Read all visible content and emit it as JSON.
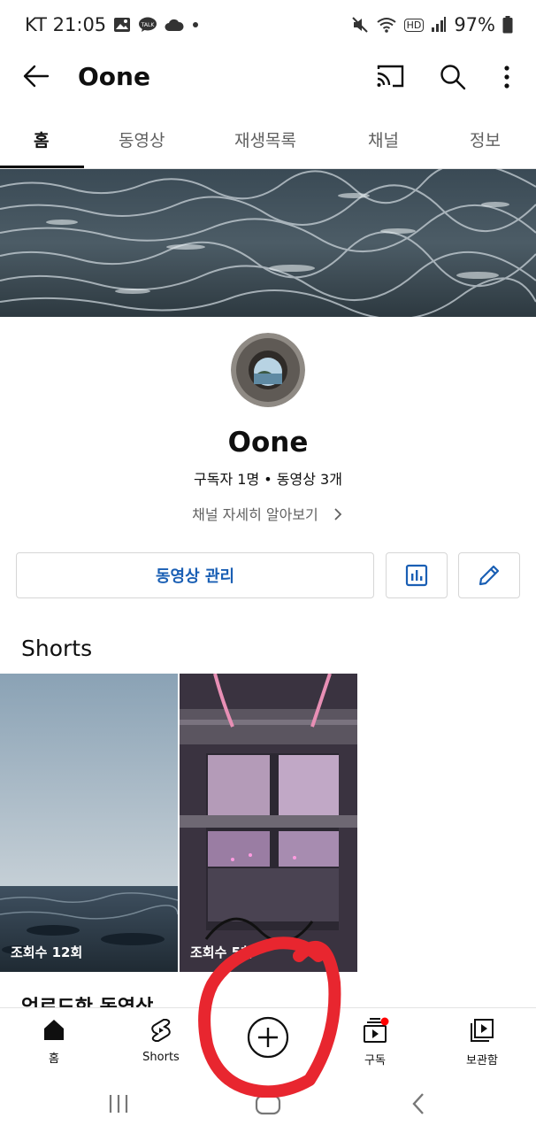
{
  "status": {
    "carrier_time": "KT 21:05",
    "battery": "97%",
    "hd": "HD"
  },
  "header": {
    "title": "Oone"
  },
  "tabs": [
    {
      "label": "홈",
      "active": true
    },
    {
      "label": "동영상"
    },
    {
      "label": "재생목록"
    },
    {
      "label": "채널"
    },
    {
      "label": "정보"
    }
  ],
  "channel": {
    "name": "Oone",
    "meta": "구독자 1명 • 동영상 3개",
    "more": "채널 자세히 알아보기"
  },
  "actions": {
    "manage_videos": "동영상 관리"
  },
  "shorts": {
    "title": "Shorts",
    "items": [
      {
        "views": "조회수 12회"
      },
      {
        "views": "조회수 5회"
      }
    ]
  },
  "uploaded_title": "업로드한 동영상",
  "bottom_nav": {
    "home": "홈",
    "shorts": "Shorts",
    "subscriptions": "구독",
    "library": "보관함"
  },
  "colors": {
    "accent_blue": "#1a5fb4",
    "annotation_red": "#e8262f",
    "notification_dot": "#ff0000"
  }
}
